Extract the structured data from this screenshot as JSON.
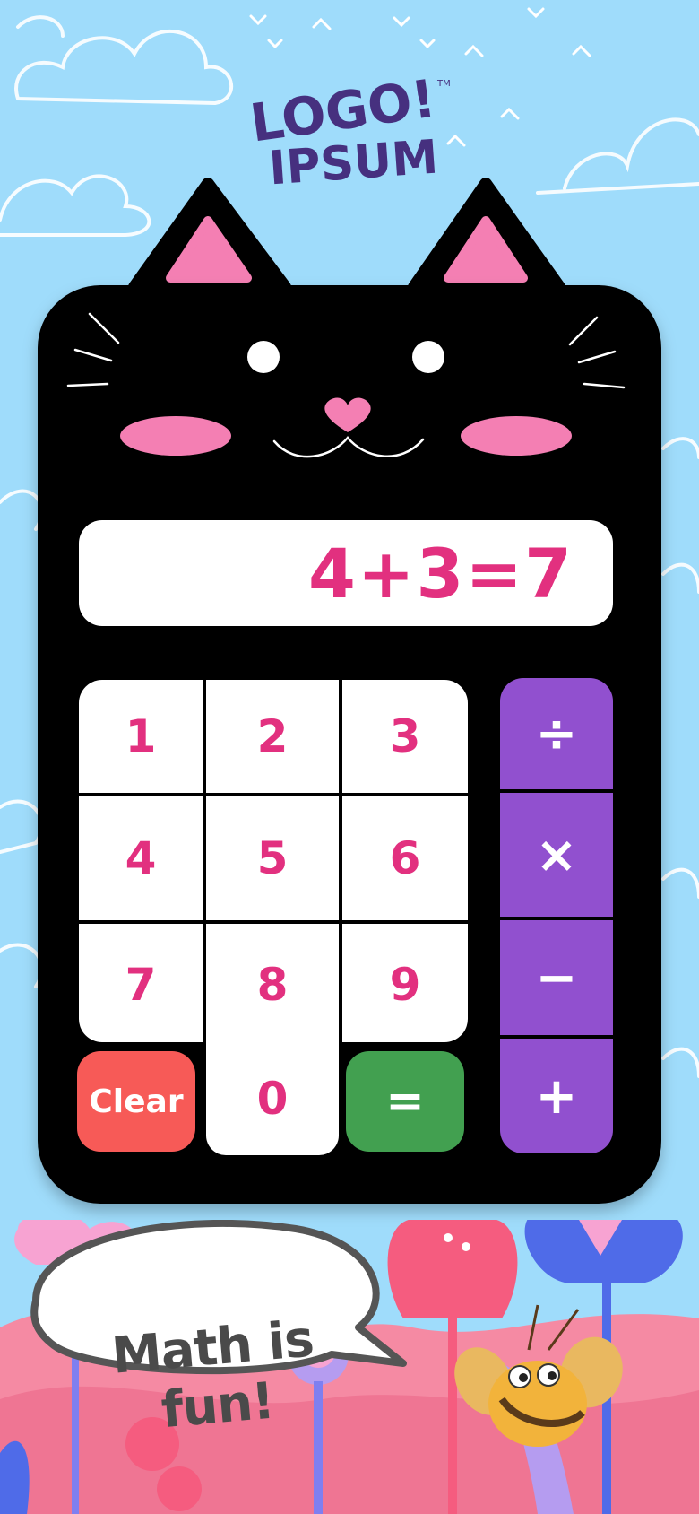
{
  "logo": {
    "line1": "LOGO!",
    "line2": "IPSUM",
    "tm": "TM"
  },
  "display": {
    "expression": "4+3=7"
  },
  "keypad": {
    "digits": [
      "1",
      "2",
      "3",
      "4",
      "5",
      "6",
      "7",
      "8",
      "9"
    ],
    "zero": "0",
    "clear": "Clear",
    "equals": "="
  },
  "operators": [
    "÷",
    "×",
    "−",
    "+"
  ],
  "speech_bubble": {
    "text": "Math is fun!"
  },
  "colors": {
    "sky": "#9fdcfb",
    "cat": "#000000",
    "accent_pink": "#e2307f",
    "blush": "#f47fb3",
    "operator_purple": "#9150cf",
    "clear_red": "#f75a57",
    "equals_green": "#42a050"
  },
  "icons": [
    "cat-ears-icon",
    "cat-eyes-icon",
    "cat-nose-icon",
    "bee-icon",
    "flower-icon",
    "cloud-icon",
    "bird-icon"
  ]
}
